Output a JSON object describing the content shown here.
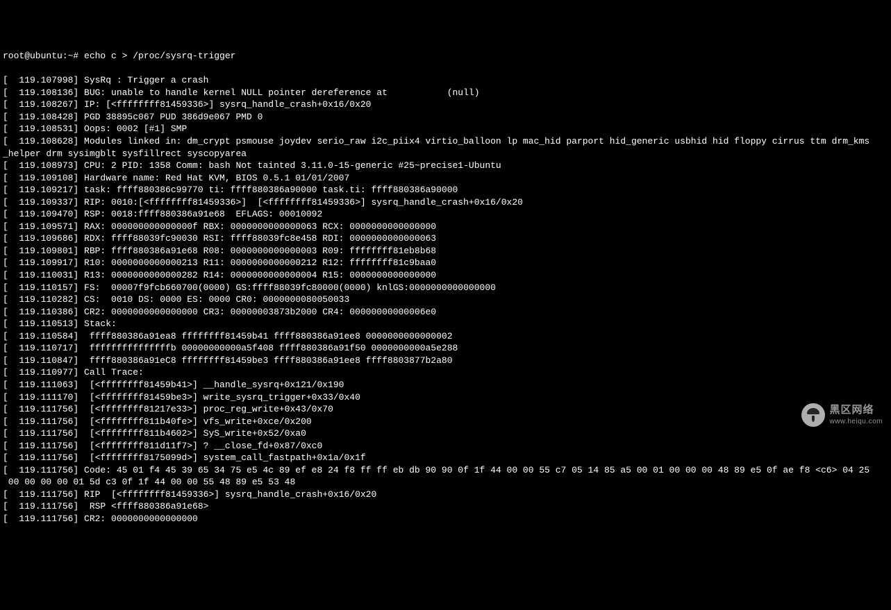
{
  "prompt": "root@ubuntu:~# echo c > /proc/sysrq-trigger",
  "lines": [
    "[  119.107998] SysRq : Trigger a crash",
    "[  119.108136] BUG: unable to handle kernel NULL pointer dereference at           (null)",
    "[  119.108267] IP: [<ffffffff81459336>] sysrq_handle_crash+0x16/0x20",
    "[  119.108428] PGD 38895c067 PUD 386d9e067 PMD 0",
    "[  119.108531] Oops: 0002 [#1] SMP",
    "[  119.108628] Modules linked in: dm_crypt psmouse joydev serio_raw i2c_piix4 virtio_balloon lp mac_hid parport hid_generic usbhid hid floppy cirrus ttm drm_kms",
    "_helper drm sysimgblt sysfillrect syscopyarea",
    "[  119.108973] CPU: 2 PID: 1358 Comm: bash Not tainted 3.11.0-15-generic #25~precise1-Ubuntu",
    "[  119.109108] Hardware name: Red Hat KVM, BIOS 0.5.1 01/01/2007",
    "[  119.109217] task: ffff880386c99770 ti: ffff880386a90000 task.ti: ffff880386a90000",
    "[  119.109337] RIP: 0010:[<ffffffff81459336>]  [<ffffffff81459336>] sysrq_handle_crash+0x16/0x20",
    "[  119.109470] RSP: 0018:ffff880386a91e68  EFLAGS: 00010092",
    "[  119.109571] RAX: 000000000000000f RBX: 0000000000000063 RCX: 0000000000000000",
    "[  119.109686] RDX: ffff88039fc90030 RSI: ffff88039fc8e458 RDI: 0000000000000063",
    "[  119.109801] RBP: ffff880386a91e68 R08: 0000000000000003 R09: ffffffff81eb8b68",
    "[  119.109917] R10: 0000000000000213 R11: 0000000000000212 R12: ffffffff81c9baa0",
    "[  119.110031] R13: 0000000000000282 R14: 0000000000000004 R15: 0000000000000000",
    "[  119.110157] FS:  00007f9fcb660700(0000) GS:ffff88039fc80000(0000) knlGS:0000000000000000",
    "[  119.110282] CS:  0010 DS: 0000 ES: 0000 CR0: 0000000080050033",
    "[  119.110386] CR2: 0000000000000000 CR3: 00000003873b2000 CR4: 00000000000006e0",
    "[  119.110513] Stack:",
    "[  119.110584]  ffff880386a91ea8 ffffffff81459b41 ffff880386a91ee8 0000000000000002",
    "[  119.110717]  fffffffffffffffb 00000000000a5f408 ffff880386a91f50 0000000000a5e288",
    "[  119.110847]  ffff880386a91eC8 ffffffff81459be3 ffff880386a91ee8 ffff8803877b2a80",
    "[  119.110977] Call Trace:",
    "[  119.111063]  [<ffffffff81459b41>] __handle_sysrq+0x121/0x190",
    "[  119.111170]  [<ffffffff81459be3>] write_sysrq_trigger+0x33/0x40",
    "[  119.111756]  [<ffffffff81217e33>] proc_reg_write+0x43/0x70",
    "[  119.111756]  [<ffffffff811b40fe>] vfs_write+0xce/0x200",
    "[  119.111756]  [<ffffffff811b4602>] SyS_write+0x52/0xa0",
    "[  119.111756]  [<ffffffff811d11f7>] ? __close_fd+0x87/0xc0",
    "[  119.111756]  [<ffffffff8175099d>] system_call_fastpath+0x1a/0x1f",
    "[  119.111756] Code: 45 01 f4 45 39 65 34 75 e5 4c 89 ef e8 24 f8 ff ff eb db 90 90 0f 1f 44 00 00 55 c7 05 14 85 a5 00 01 00 00 00 48 89 e5 0f ae f8 <c6> 04 25",
    " 00 00 00 00 01 5d c3 0f 1f 44 00 00 55 48 89 e5 53 48",
    "[  119.111756] RIP  [<ffffffff81459336>] sysrq_handle_crash+0x16/0x20",
    "[  119.111756]  RSP <ffff880386a91e68>",
    "[  119.111756] CR2: 0000000000000000"
  ],
  "watermark": {
    "main": "黑区网络",
    "sub": "www.heiqu.com"
  }
}
